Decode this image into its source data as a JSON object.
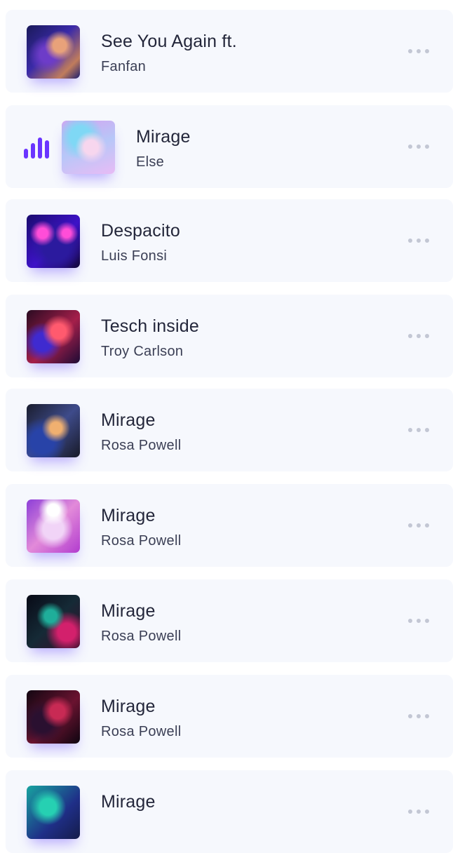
{
  "songs": [
    {
      "title": "See You Again ft.",
      "artist": "Fanfan",
      "art_icon": "album-art"
    },
    {
      "title": "Mirage",
      "artist": "Else",
      "art_icon": "album-art",
      "playing": true
    },
    {
      "title": "Despacito",
      "artist": "Luis Fonsi",
      "art_icon": "album-art"
    },
    {
      "title": "Tesch inside",
      "artist": "Troy Carlson",
      "art_icon": "album-art"
    },
    {
      "title": "Mirage",
      "artist": "Rosa Powell",
      "art_icon": "album-art"
    },
    {
      "title": "Mirage",
      "artist": "Rosa Powell",
      "art_icon": "album-art"
    },
    {
      "title": "Mirage",
      "artist": "Rosa Powell",
      "art_icon": "album-art"
    },
    {
      "title": "Mirage",
      "artist": "Rosa Powell",
      "art_icon": "album-art"
    },
    {
      "title": "Mirage",
      "artist": "",
      "art_icon": "album-art"
    }
  ],
  "icons": {
    "more": "more-dots-icon",
    "now_playing": "equalizer-icon"
  },
  "colors": {
    "accent": "#6a35ff",
    "row_background": "#f6f8fd",
    "title_text": "#23263a",
    "artist_text": "#3b3f55",
    "more_dots": "#c3c7d4"
  }
}
